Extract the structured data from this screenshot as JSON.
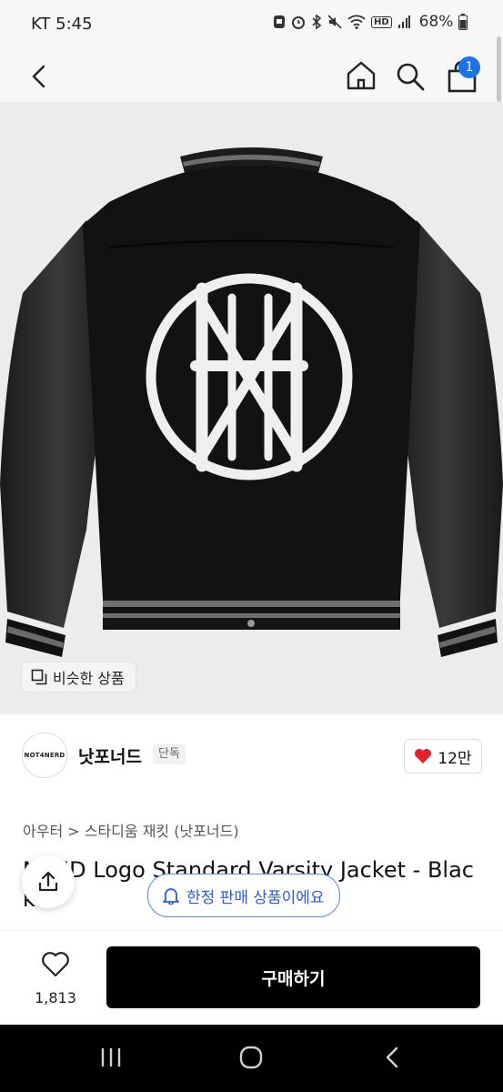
{
  "status_bar": {
    "carrier_time": "KT 5:45",
    "battery": "68%",
    "icons": [
      "photo-icon",
      "alarm-icon",
      "bluetooth-icon",
      "mute-icon",
      "wifi-icon",
      "hd-icon",
      "signal-icon",
      "battery-icon"
    ],
    "hd_label": "HD"
  },
  "header": {
    "icons": [
      "back-icon",
      "home-icon",
      "search-icon",
      "bag-icon"
    ],
    "cart_count": "1",
    "accent": "#1a73e8"
  },
  "hero": {
    "similar_label": "비슷한 상품",
    "icon": "copy-icon"
  },
  "brand": {
    "logo_text": "NOT4NERD",
    "name": "낫포너드",
    "tag": "단독",
    "likes": "12만",
    "heart_color": "#e5202e"
  },
  "breadcrumb": {
    "text": "아우터 > 스타디움 재킷 (낫포너드)"
  },
  "product": {
    "title": "N4ND Logo Standard Varsity Jacket - Black"
  },
  "overlay": {
    "limited_label": "한정 판매 상품이에요",
    "bell_icon": "bell-icon",
    "share_icon": "share-icon",
    "pill_color": "#2a5bd7"
  },
  "action_bar": {
    "wish_count": "1,813",
    "buy_label": "구매하기"
  },
  "system_nav": {
    "icons": [
      "recent-apps-icon",
      "home-circle-icon",
      "back-chevron-icon"
    ]
  }
}
